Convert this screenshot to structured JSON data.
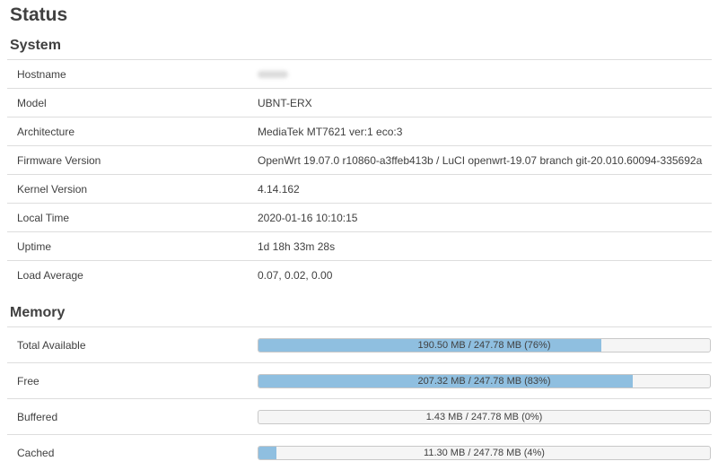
{
  "page": {
    "title": "Status"
  },
  "system": {
    "title": "System",
    "rows": [
      {
        "key": "Hostname",
        "value": ""
      },
      {
        "key": "Model",
        "value": "UBNT-ERX"
      },
      {
        "key": "Architecture",
        "value": "MediaTek MT7621 ver:1 eco:3"
      },
      {
        "key": "Firmware Version",
        "value": "OpenWrt 19.07.0 r10860-a3ffeb413b / LuCI openwrt-19.07 branch git-20.010.60094-335692a"
      },
      {
        "key": "Kernel Version",
        "value": "4.14.162"
      },
      {
        "key": "Local Time",
        "value": "2020-01-16 10:10:15"
      },
      {
        "key": "Uptime",
        "value": "1d 18h 33m 28s"
      },
      {
        "key": "Load Average",
        "value": "0.07, 0.02, 0.00"
      }
    ]
  },
  "memory": {
    "title": "Memory",
    "rows": [
      {
        "key": "Total Available",
        "label": "190.50 MB / 247.78 MB (76%)",
        "percent": 76
      },
      {
        "key": "Free",
        "label": "207.32 MB / 247.78 MB (83%)",
        "percent": 83
      },
      {
        "key": "Buffered",
        "label": "1.43 MB / 247.78 MB (0%)",
        "percent": 0
      },
      {
        "key": "Cached",
        "label": "11.30 MB / 247.78 MB (4%)",
        "percent": 4
      }
    ]
  },
  "colors": {
    "bar_fill": "#8fbfe0",
    "bar_track": "#f5f5f5",
    "divider": "#dddddd"
  }
}
